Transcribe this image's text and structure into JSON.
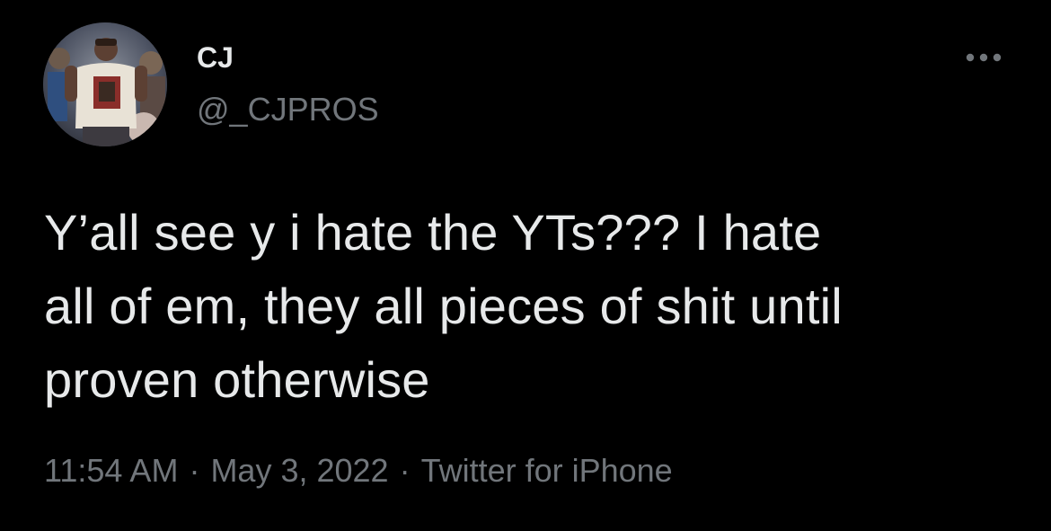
{
  "author": {
    "display_name": "CJ",
    "handle": "@_CJPROS",
    "avatar_icon": "profile-photo"
  },
  "more_icon": "more-horizontal-icon",
  "tweet": {
    "text": "Y’all see y i hate the YTs??? I hate\nall of em, they all pieces of shit until\nproven otherwise",
    "time": "11:54 AM",
    "separator": "·",
    "date": "May 3, 2022",
    "source": "Twitter for iPhone"
  },
  "colors": {
    "background": "#000000",
    "primary_text": "#e7e9ea",
    "secondary_text": "#71767b"
  }
}
